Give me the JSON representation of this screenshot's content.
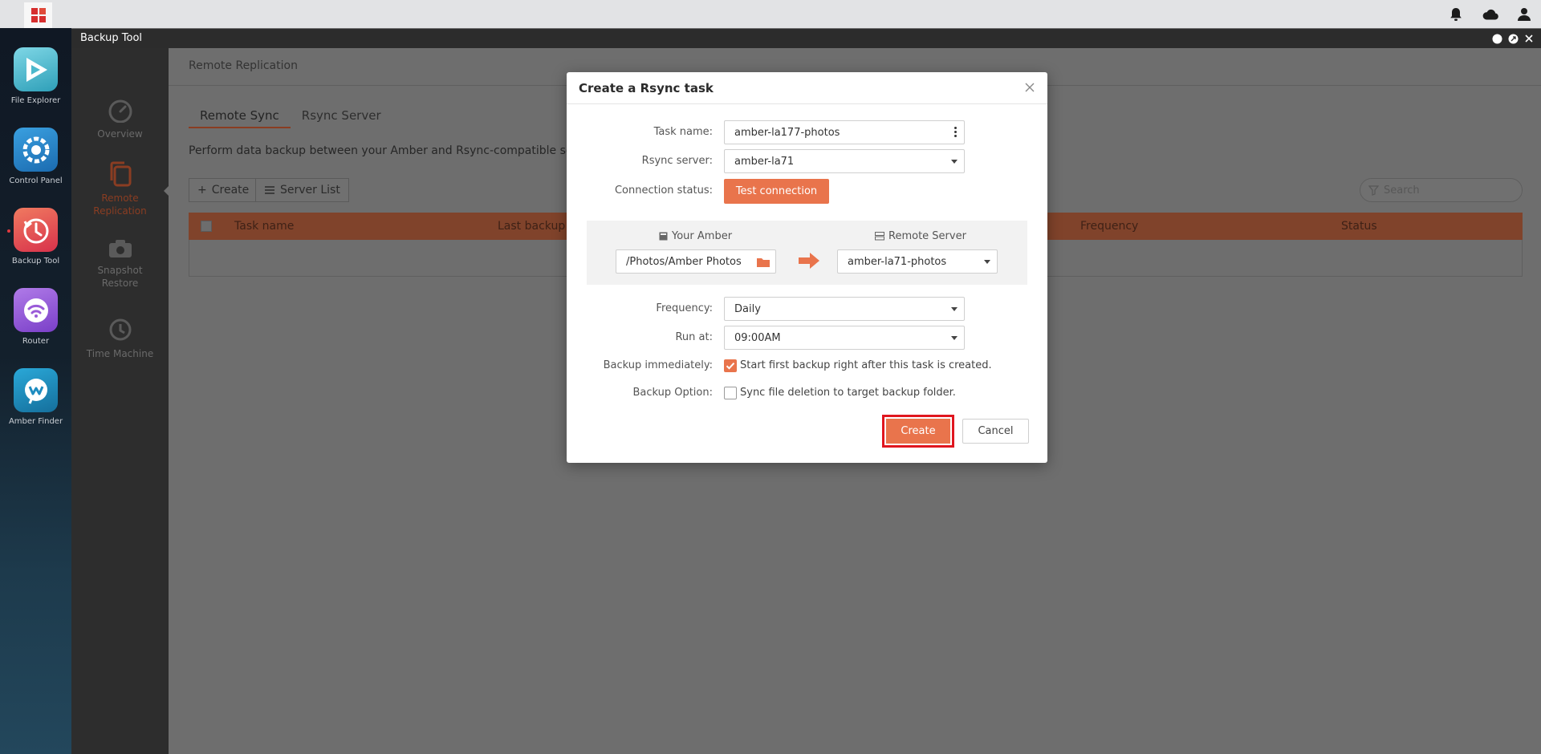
{
  "app_window": {
    "title": "Backup Tool"
  },
  "dock": {
    "items": [
      {
        "label": "File Explorer"
      },
      {
        "label": "Control Panel"
      },
      {
        "label": "Backup Tool"
      },
      {
        "label": "Router"
      },
      {
        "label": "Amber Finder"
      }
    ]
  },
  "sidebar": {
    "items": [
      {
        "label": "Overview"
      },
      {
        "label": "Remote Replication"
      },
      {
        "label": "Snapshot Restore"
      },
      {
        "label": "Time Machine"
      }
    ]
  },
  "main": {
    "breadcrumb": "Remote Replication",
    "tabs": [
      {
        "label": "Remote Sync"
      },
      {
        "label": "Rsync Server"
      }
    ],
    "description": "Perform data backup between your Amber and Rsync-compatible serve",
    "toolbar": {
      "create_label": "Create",
      "server_list_label": "Server List",
      "search_placeholder": "Search"
    },
    "table": {
      "columns": [
        "Task name",
        "Last backup",
        "Frequency",
        "Status"
      ]
    }
  },
  "dialog": {
    "title": "Create a Rsync task",
    "task_name_label": "Task name:",
    "task_name_value": "amber-la177-photos",
    "rsync_server_label": "Rsync server:",
    "rsync_server_value": "amber-la71",
    "connection_status_label": "Connection status:",
    "test_connection_label": "Test connection",
    "source_title": "Your Amber",
    "source_path": "/Photos/Amber Photos",
    "dest_title": "Remote Server",
    "dest_value": "amber-la71-photos",
    "frequency_label": "Frequency:",
    "frequency_value": "Daily",
    "run_at_label": "Run at:",
    "run_at_value": "09:00AM",
    "backup_immediately_label": "Backup immediately:",
    "backup_immediately_text": "Start first backup right after this task is created.",
    "backup_option_label": "Backup Option:",
    "backup_option_text": "Sync file deletion to target backup folder.",
    "create_label": "Create",
    "cancel_label": "Cancel"
  },
  "colors": {
    "accent": "#e9744c",
    "highlight": "#e0161f"
  }
}
